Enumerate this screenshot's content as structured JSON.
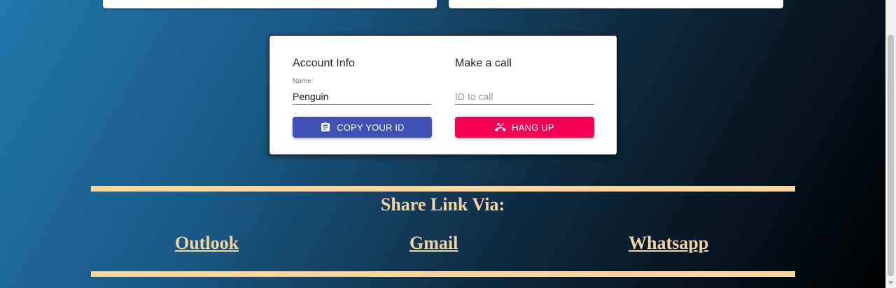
{
  "account": {
    "heading": "Account Info",
    "name_label": "Name",
    "name_value": "Penguin",
    "copy_button": "COPY YOUR ID",
    "copy_icon": "clipboard-icon"
  },
  "call": {
    "heading": "Make a call",
    "id_placeholder": "ID to call",
    "id_value": "",
    "hangup_button": "HANG UP",
    "hangup_icon": "phone-missed-icon"
  },
  "share": {
    "title": "Share Link Via:",
    "links": [
      "Outlook",
      "Gmail",
      "Whatsapp"
    ]
  },
  "colors": {
    "primary": "#3f51b5",
    "secondary": "#f50057",
    "accent": "#fcd59c"
  }
}
